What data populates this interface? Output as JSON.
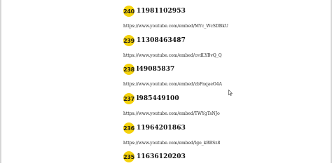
{
  "entries": [
    {
      "num": "240",
      "id": "11981102953",
      "url": "https://www.youtube.com/embed/MYc_WcSDBkU"
    },
    {
      "num": "239",
      "id": "11308463487",
      "url": "https://www.youtube.com/embed/cvdLYBvQ_Q"
    },
    {
      "num": "238",
      "id": "l49085837",
      "url": "https://www.youtube.com/embed/zbFnqaeO4A"
    },
    {
      "num": "237",
      "id": "l985449100",
      "url": "https://www.youtube.com/embed/TWYgTsNJo"
    },
    {
      "num": "236",
      "id": "11964201863",
      "url": "https://www.youtube.com/embed/Igo_kBBSz8"
    },
    {
      "num": "235",
      "id": "11636120203",
      "url": ""
    }
  ]
}
